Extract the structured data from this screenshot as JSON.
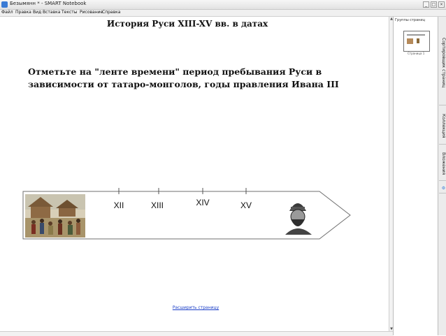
{
  "window": {
    "title": "Безымянн * - SMART Notebook",
    "buttons": [
      "_",
      "□",
      "×"
    ]
  },
  "menu": {
    "items": [
      "Файл",
      "Правка",
      "Вид",
      "Вставка",
      "Тексты",
      "Рисование",
      "Справка"
    ]
  },
  "slide": {
    "title": "История Руси XIII-XV вв. в датах",
    "task": "Отметьте на \"ленте времени\" период пребывания Руси в зависимости от татаро-монголов, годы правления Ивана III",
    "timeline": {
      "centuries": [
        "XII",
        "XIII",
        "XIV",
        "XV"
      ]
    },
    "images": {
      "left": "painting-icon",
      "right": "portrait-icon"
    }
  },
  "footer": {
    "link": "Расширить страницу"
  },
  "sidebar": {
    "header": "Группы страниц",
    "thumb_label": "Страница 1"
  },
  "tabs": [
    "Сортировщик страниц",
    "Коллекция",
    "Вложения",
    "Свойства"
  ]
}
